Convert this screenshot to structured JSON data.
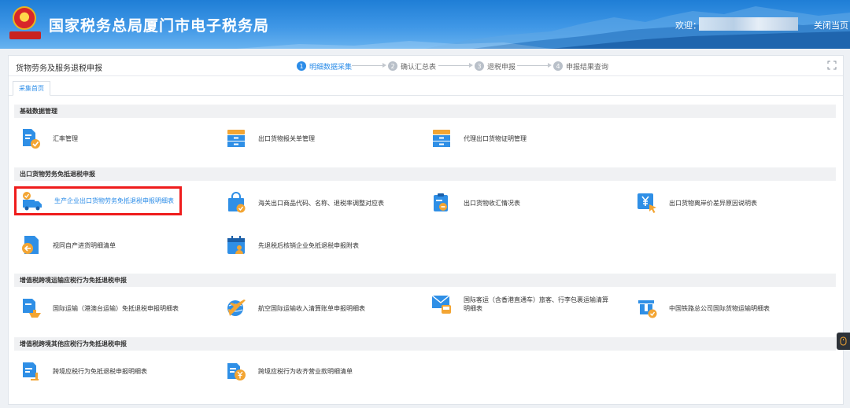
{
  "header": {
    "site_title": "国家税务总局厦门市电子税务局",
    "welcome": "欢迎：",
    "close_home": "关闭当页"
  },
  "topbar": {
    "module_title": "货物劳务及服务退税申报",
    "steps": [
      {
        "num": "1",
        "label": "明细数据采集",
        "active": true
      },
      {
        "num": "2",
        "label": "确认汇总表",
        "active": false
      },
      {
        "num": "3",
        "label": "退税申报",
        "active": false
      },
      {
        "num": "4",
        "label": "申报结果查询",
        "active": false
      }
    ]
  },
  "tabs": [
    {
      "label": "采集首页"
    }
  ],
  "sections": [
    {
      "title": "基础数据管理",
      "items": [
        {
          "label": "汇率管理",
          "icon": "document-check-icon"
        },
        {
          "label": "出口货物报关单管理",
          "icon": "file-cabinet-icon"
        },
        {
          "label": "代理出口货物证明管理",
          "icon": "file-cabinet-icon"
        }
      ]
    },
    {
      "title": "出口货物劳务免抵退税申报",
      "items": [
        {
          "label": "生产企业出口货物劳务免抵退税申报明细表",
          "icon": "truck-check-icon"
        },
        {
          "label": "海关出口商品代码、名称、退税率调整对应表",
          "icon": "shopping-bag-check-icon"
        },
        {
          "label": "出口货物收汇情况表",
          "icon": "clipboard-coin-icon"
        },
        {
          "label": "出口货物离岸价差异原因说明表",
          "icon": "yen-cursor-icon"
        },
        {
          "label": "视同自产进货明细清单",
          "icon": "document-arrow-icon"
        },
        {
          "label": "先退税后核销企业免抵退税申报附表",
          "icon": "calendar-person-icon"
        }
      ]
    },
    {
      "title": "增值税跨境运输应税行为免抵退税申报",
      "items": [
        {
          "label": "国际运输（港澳台运输）免抵退税申报明细表",
          "icon": "document-ship-icon"
        },
        {
          "label": "航空国际运输收入清算账单申报明细表",
          "icon": "airplane-globe-icon"
        },
        {
          "label": "国际客运（含香港直通车）旅客、行李包裹运输清算函件明细表",
          "label_line2": "明细表",
          "icon": "envelope-bus-icon"
        },
        {
          "label": "中国铁路总公司国际货物运输明细表",
          "icon": "train-check-icon"
        }
      ]
    },
    {
      "title": "增值税跨境其他应税行为免抵退税申报",
      "items": [
        {
          "label": "跨境应税行为免抵退税申报明细表",
          "icon": "document-person-icon"
        },
        {
          "label": "跨境应税行为收齐营业款明细清单",
          "icon": "document-yen-icon"
        }
      ]
    }
  ],
  "colors": {
    "accent": "#2b8ce8",
    "highlight_border": "#ef1c1c",
    "icon_blue": "#2f8fe6",
    "icon_orange": "#f3a533"
  }
}
